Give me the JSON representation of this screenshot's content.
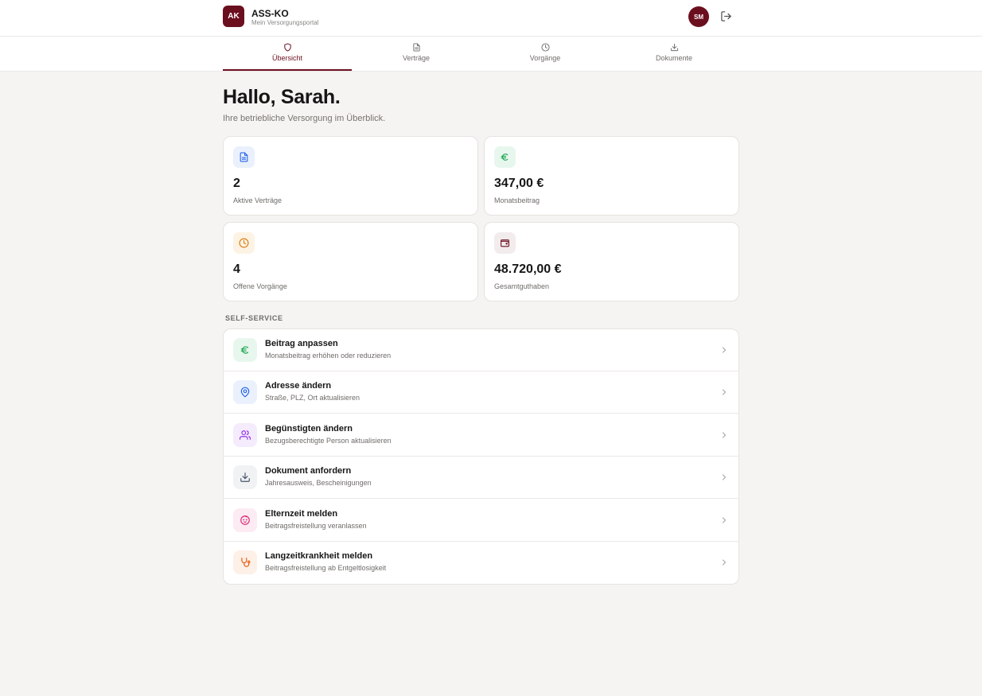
{
  "header": {
    "logo": "AK",
    "brand": "ASS-KO",
    "subtitle": "Mein Versorgungsportal",
    "avatar": "SM",
    "logout_icon": "logout-icon"
  },
  "tabs": [
    {
      "label": "Übersicht",
      "icon": "shield-icon",
      "active": true
    },
    {
      "label": "Verträge",
      "icon": "document-icon",
      "active": false
    },
    {
      "label": "Vorgänge",
      "icon": "clock-icon",
      "active": false
    },
    {
      "label": "Dokumente",
      "icon": "download-icon",
      "active": false
    }
  ],
  "greeting": "Hallo, Sarah.",
  "intro": "Ihre betriebliche Versorgung im Überblick.",
  "stats": [
    {
      "value": "2",
      "label": "Aktive Verträge",
      "icon": "document-icon",
      "color": "#2563eb",
      "bg": "#eaf1fd"
    },
    {
      "value": "347,00 €",
      "label": "Monatsbeitrag",
      "icon": "euro-icon",
      "color": "#16a34a",
      "bg": "#e8f7ee"
    },
    {
      "value": "4",
      "label": "Offene Vorgänge",
      "icon": "clock-icon",
      "color": "#d97706",
      "bg": "#fdf3e4"
    },
    {
      "value": "48.720,00 €",
      "label": "Gesamtguthaben",
      "icon": "wallet-icon",
      "color": "#6b0f1f",
      "bg": "#f3ecec"
    }
  ],
  "self_service": {
    "title": "SELF-SERVICE",
    "items": [
      {
        "title": "Beitrag anpassen",
        "desc": "Monatsbeitrag erhöhen oder reduzieren",
        "icon": "euro-icon",
        "color": "#16a34a",
        "bg": "#e8f7ee"
      },
      {
        "title": "Adresse ändern",
        "desc": "Straße, PLZ, Ort aktualisieren",
        "icon": "map-pin-icon",
        "color": "#2563eb",
        "bg": "#eaf1fd"
      },
      {
        "title": "Begünstigten ändern",
        "desc": "Bezugsberechtigte Person aktualisieren",
        "icon": "users-icon",
        "color": "#9333ea",
        "bg": "#f4ebfc"
      },
      {
        "title": "Dokument anfordern",
        "desc": "Jahresausweis, Bescheinigungen",
        "icon": "download-icon",
        "color": "#475569",
        "bg": "#f1f2f4"
      },
      {
        "title": "Elternzeit melden",
        "desc": "Beitragsfreistellung veranlassen",
        "icon": "baby-icon",
        "color": "#db2777",
        "bg": "#fcebf3"
      },
      {
        "title": "Langzeitkrankheit melden",
        "desc": "Beitragsfreistellung ab Entgeltlosigkeit",
        "icon": "stethoscope-icon",
        "color": "#ea580c",
        "bg": "#fdf0e7"
      }
    ]
  },
  "colors": {
    "brand": "#6b0f1f",
    "background": "#f5f4f2"
  }
}
